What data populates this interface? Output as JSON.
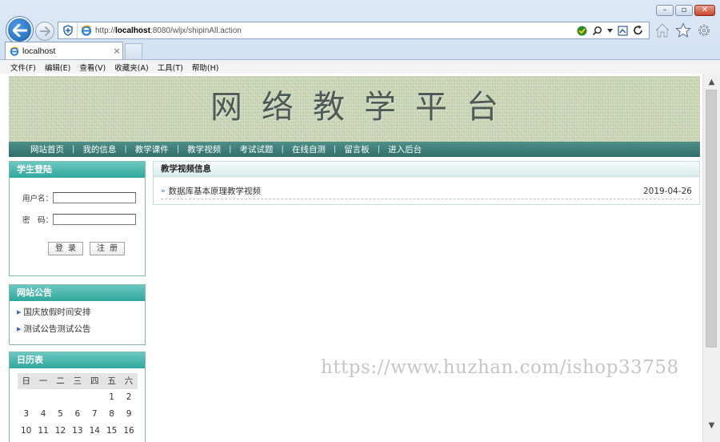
{
  "browser": {
    "url_prefix": "http://",
    "url_host": "localhost",
    "url_rest": ":8080/wljx/shipinAll.action",
    "tab_title": "localhost",
    "tab_close": "×",
    "menu": [
      "文件(F)",
      "编辑(E)",
      "查看(V)",
      "收藏夹(A)",
      "工具(T)",
      "帮助(H)"
    ]
  },
  "site": {
    "title": "网络教学平台",
    "nav": [
      "网站首页",
      "我的信息",
      "教学课件",
      "教学视频",
      "考试试题",
      "在线自测",
      "留言板",
      "进入后台"
    ],
    "nav_separator": "|"
  },
  "login": {
    "heading": "学生登陆",
    "username_label": "用户名：",
    "password_label": "密　码：",
    "login_button": "登录",
    "register_button": "注册"
  },
  "notice": {
    "heading": "网站公告",
    "items": [
      "国庆放假时间安排",
      "测试公告测试公告"
    ]
  },
  "calendar": {
    "heading": "日历表",
    "weekdays": [
      "日",
      "一",
      "二",
      "三",
      "四",
      "五",
      "六"
    ],
    "rows": [
      [
        "",
        "",
        "",
        "",
        "",
        "1",
        "2"
      ],
      [
        "3",
        "4",
        "5",
        "6",
        "7",
        "8",
        "9"
      ],
      [
        "10",
        "11",
        "12",
        "13",
        "14",
        "15",
        "16"
      ]
    ]
  },
  "videos": {
    "heading": "教学视频信息",
    "items": [
      {
        "title": "数据库基本原理教学视频",
        "date": "2019-04-26"
      }
    ]
  },
  "watermark": "https://www.huzhan.com/ishop33758",
  "colors": {
    "nav_bar": "#2f6e69",
    "panel_header": "#2ea79c",
    "panel_border": "#7fbbb4",
    "ie_back": "#1a5fb4"
  },
  "icons": [
    "back-arrow-icon",
    "forward-arrow-icon",
    "shield-icon",
    "ie-logo-icon",
    "compat-view-icon",
    "search-icon",
    "refresh-icon",
    "home-icon",
    "favorites-star-icon",
    "gear-icon"
  ]
}
